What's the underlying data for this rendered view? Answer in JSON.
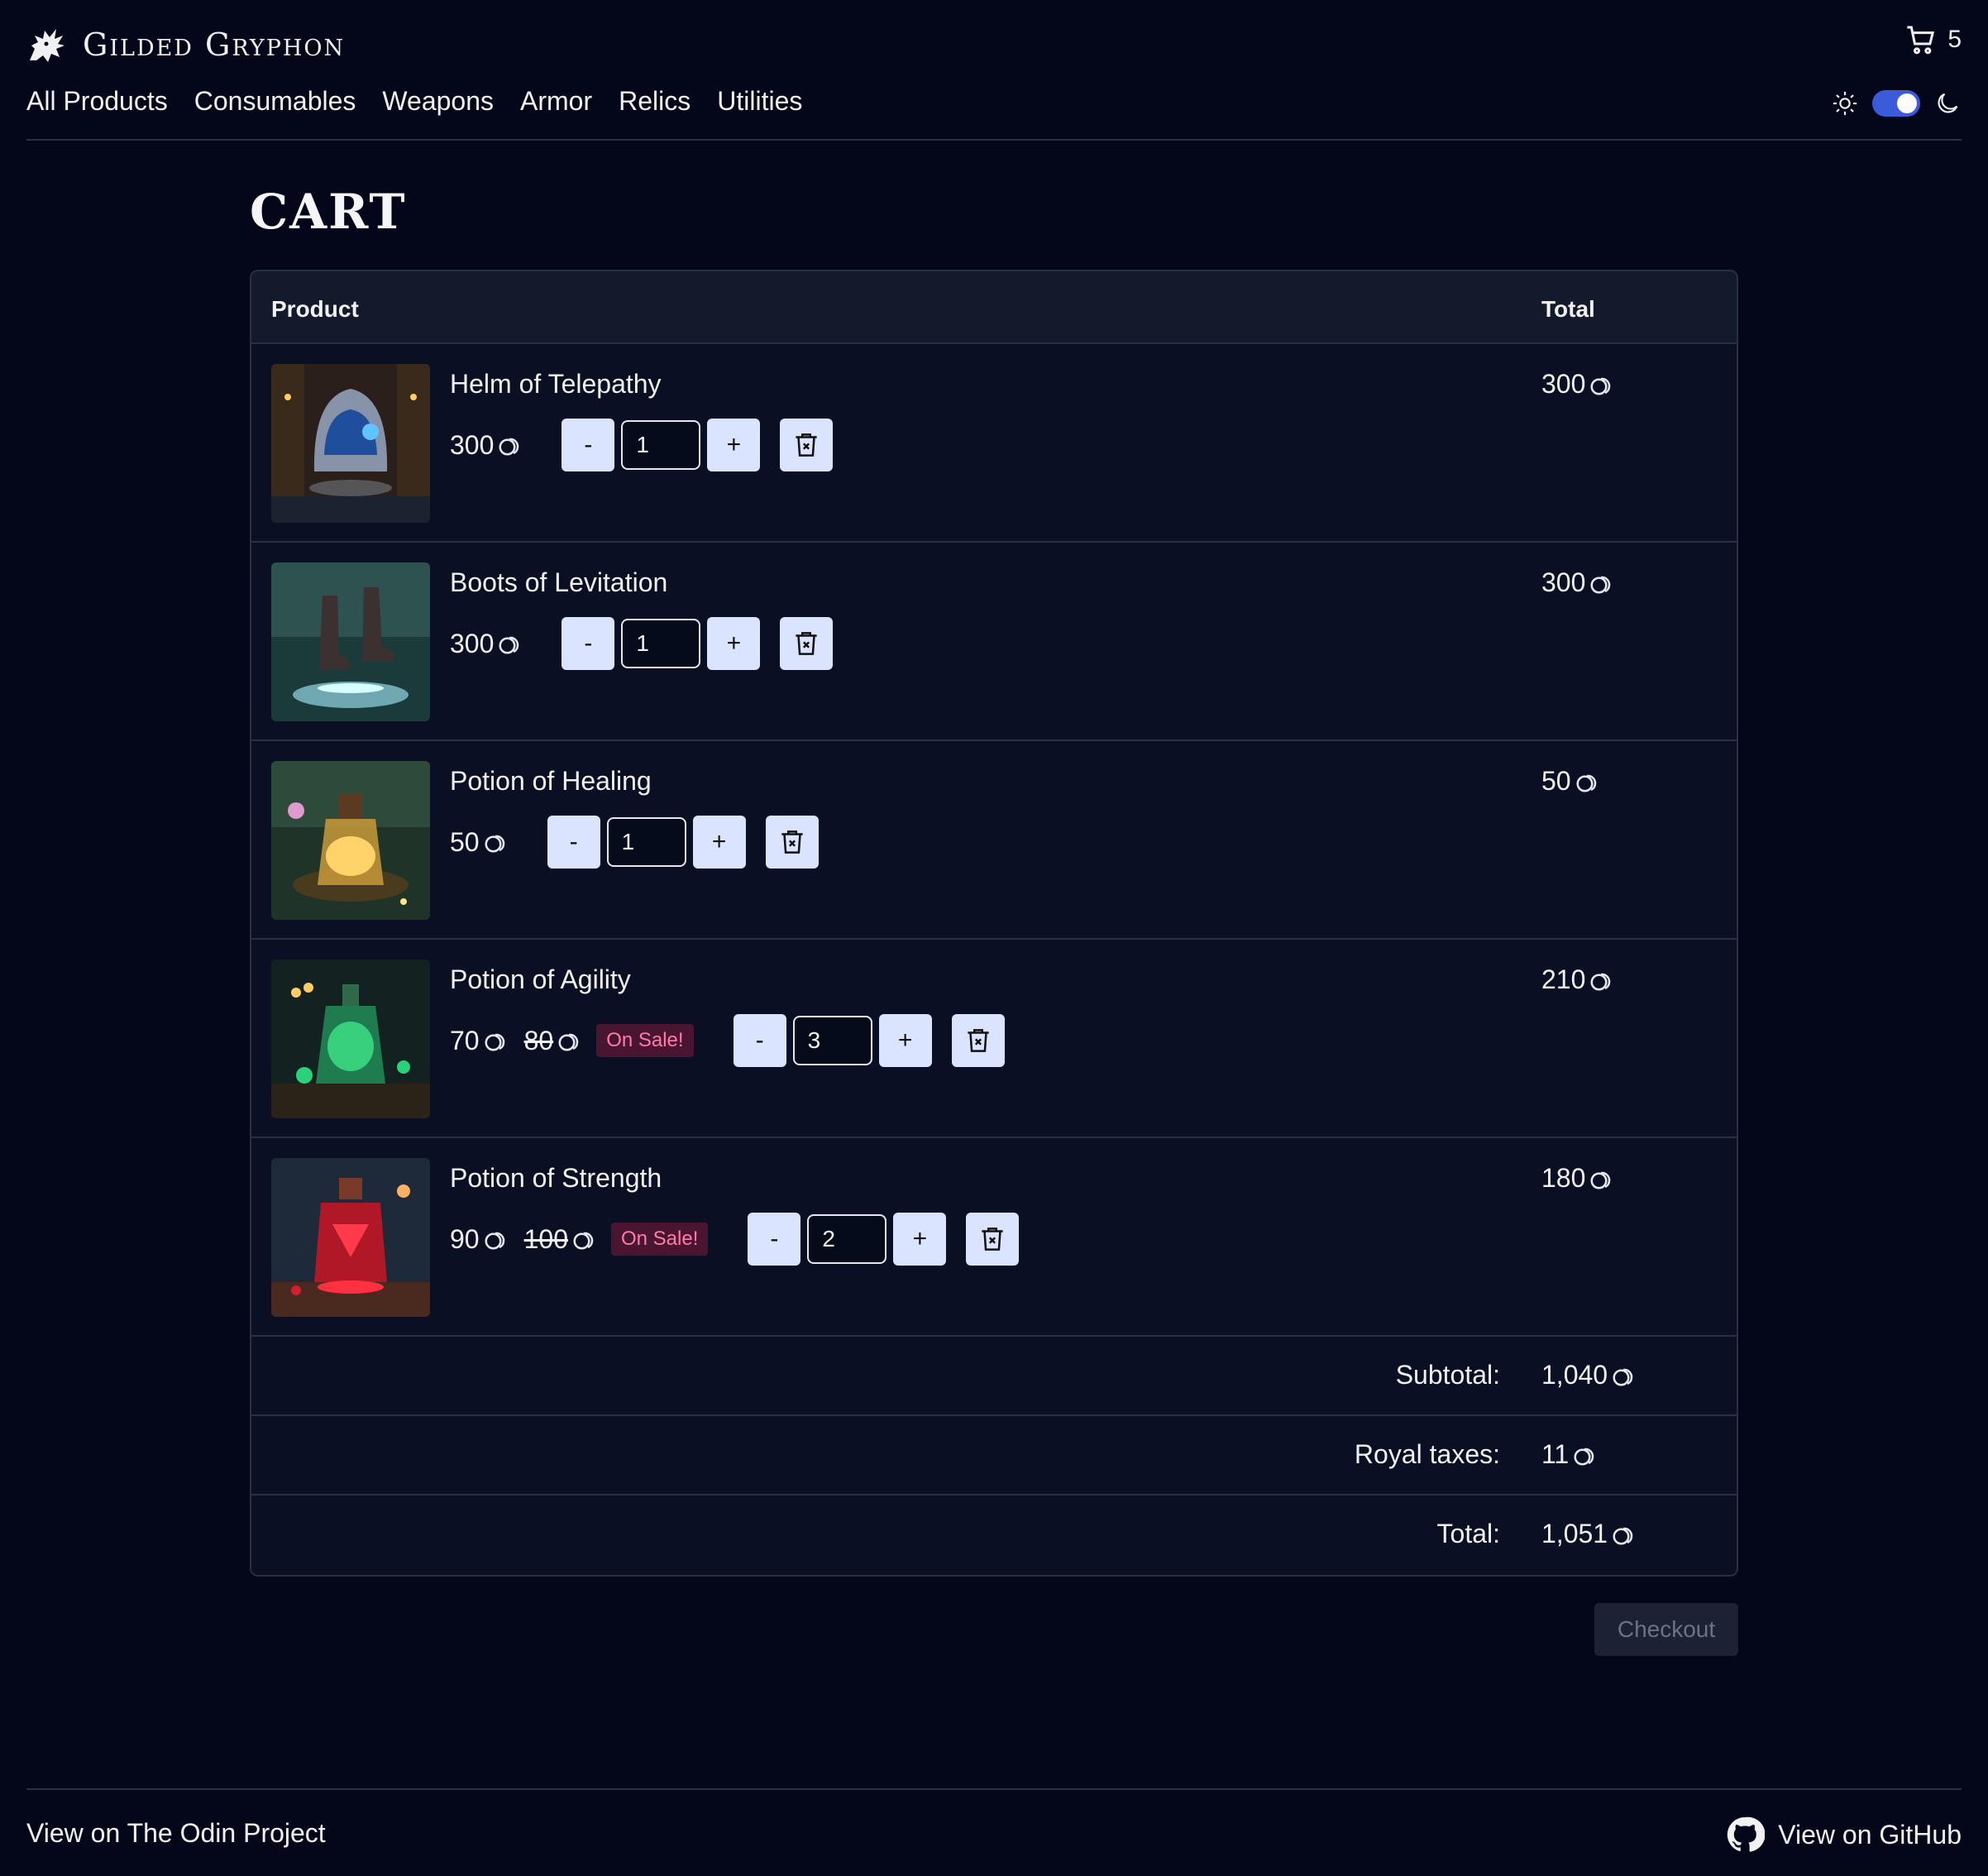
{
  "header": {
    "brand": "Gilded Gryphon",
    "logo_icon": "gryphon-logo",
    "cart_count": "5",
    "cart_icon": "cart-icon"
  },
  "nav": {
    "items": [
      "All Products",
      "Consumables",
      "Weapons",
      "Armor",
      "Relics",
      "Utilities"
    ]
  },
  "theme": {
    "light_icon": "sun-icon",
    "dark_icon": "moon-icon",
    "dark_mode": true
  },
  "page": {
    "title": "CART"
  },
  "cart": {
    "headers": {
      "product": "Product",
      "total": "Total"
    },
    "items": [
      {
        "name": "Helm of Telepathy",
        "price": "300",
        "quantity": "1",
        "total": "300"
      },
      {
        "name": "Boots of Levitation",
        "price": "300",
        "quantity": "1",
        "total": "300"
      },
      {
        "name": "Potion of Healing",
        "price": "50",
        "quantity": "1",
        "total": "50"
      },
      {
        "name": "Potion of Agility",
        "price": "70",
        "old_price": "80",
        "badge": "On Sale!",
        "quantity": "3",
        "total": "210"
      },
      {
        "name": "Potion of Strength",
        "price": "90",
        "old_price": "100",
        "badge": "On Sale!",
        "quantity": "2",
        "total": "180"
      }
    ],
    "buttons": {
      "decrement": "-",
      "increment": "+"
    },
    "summary": {
      "subtotal_label": "Subtotal:",
      "subtotal": "1,040",
      "tax_label": "Royal taxes:",
      "tax": "11",
      "total_label": "Total:",
      "total": "1,051"
    },
    "checkout_label": "Checkout"
  },
  "footer": {
    "odin_link": "View on The Odin Project",
    "github_link": "View on GitHub"
  },
  "colors": {
    "background": "#04071a",
    "table_bg": "#0a0f24",
    "accent": "#3b5bdb",
    "button_bg": "#dbe4ff",
    "sale_badge": "#4a1530"
  }
}
